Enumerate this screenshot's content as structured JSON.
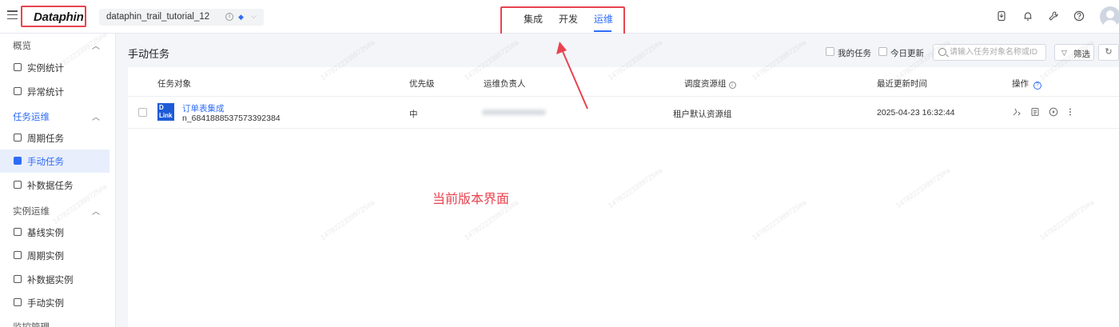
{
  "header": {
    "logo": "Dataphin",
    "project_name": "dataphin_trail_tutorial_12",
    "nav_tabs": [
      {
        "label": "集成",
        "active": false
      },
      {
        "label": "开发",
        "active": false
      },
      {
        "label": "运维",
        "active": true
      }
    ],
    "icons": [
      "download-icon",
      "bell-icon",
      "wrench-icon",
      "help-icon",
      "avatar"
    ]
  },
  "sidebar": {
    "sections": [
      {
        "title": "概览",
        "items": [
          "实例统计",
          "异常统计"
        ]
      },
      {
        "title": "任务运维",
        "items": [
          "周期任务",
          "手动任务"
        ]
      },
      {
        "title": "实例运维",
        "items": [
          "基线实例",
          "周期实例",
          "补数据实例",
          "手动实例"
        ]
      }
    ],
    "extra_items": [
      "补数据任务"
    ],
    "partial_section": "监控管理",
    "active_item": "手动任务"
  },
  "main": {
    "title": "手动任务",
    "filters": {
      "my_tasks": "我的任务",
      "updated_today": "今日更新",
      "search_placeholder": "请输入任务对象名称或ID",
      "filter_label": "筛选"
    },
    "columns": [
      "任务对象",
      "优先级",
      "运维负责人",
      "调度资源组",
      "最近更新时间",
      "操作"
    ],
    "rows": [
      {
        "icon_text": "D Link",
        "name": "订单表集成",
        "id": "n_6841888537573392384",
        "priority": "中",
        "owner": "",
        "resource_group": "租户默认资源组",
        "updated": "2025-04-23 16:32:44"
      }
    ]
  },
  "annotation": {
    "text": "当前版本界面",
    "color": "#e8434f"
  },
  "colors": {
    "accent": "#2f6cf5",
    "highlight": "#e8434f"
  },
  "watermark": "14782223399725#a"
}
